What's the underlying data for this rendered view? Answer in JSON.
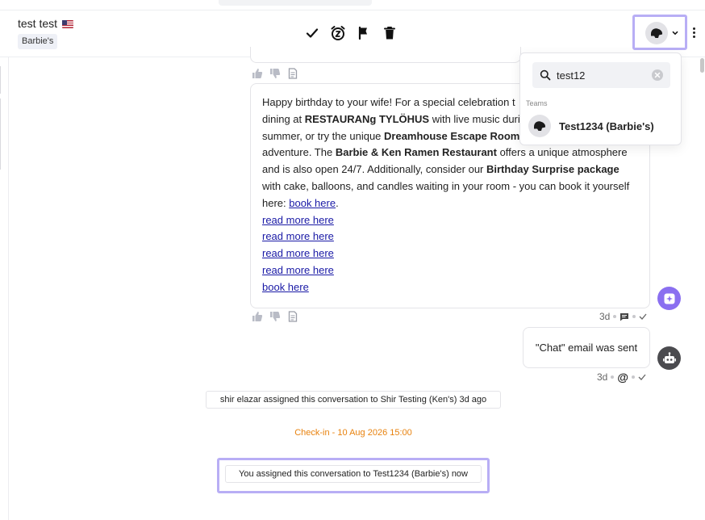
{
  "header": {
    "contact_name": "test test",
    "tag": "Barbie's"
  },
  "actions": [
    {
      "icon": "check-icon"
    },
    {
      "icon": "snooze-alarm-icon"
    },
    {
      "icon": "flag-icon"
    },
    {
      "icon": "trash-icon"
    }
  ],
  "assignee_dropdown": {
    "search_value": "test12",
    "section_label": "Teams",
    "team_option": "Test1234 (Barbie's)"
  },
  "ai_message": {
    "lines": [
      [
        "Happy birthday to your wife! For a special celebration t"
      ],
      [
        "dining at ",
        "RESTAURANg TYLÖHUS",
        " with live music durin"
      ],
      [
        "summer, or try the unique ",
        "Dreamhouse Escape Room"
      ],
      [
        "adventure. The ",
        "Barbie & Ken Ramen Restaurant",
        " offers a unique atmosphere"
      ],
      [
        "and is also open 24/7. Additionally, consider our ",
        "Birthday Surprise package"
      ],
      [
        "with cake, balloons, and candles waiting in your room - you can book it yourself"
      ],
      [
        "here: ",
        "book here",
        "."
      ]
    ],
    "links": [
      "read more here",
      "read more here",
      "read more here",
      "read more here",
      "book here"
    ],
    "time": "3d"
  },
  "system_message": {
    "text": "\"Chat\" email was sent",
    "time": "3d",
    "channel_symbol": "@"
  },
  "events": {
    "assignment_1": "shir elazar assigned this conversation to Shir Testing (Ken's) 3d ago",
    "checkin": "Check-in - 10 Aug 2026 15:00",
    "assignment_2": "You assigned this conversation to Test1234 (Barbie's) now"
  },
  "colors": {
    "highlight": "#b8aef5",
    "ai_accent": "#8a6ff0",
    "checkin": "#e8820e",
    "link": "#1a1aa6"
  }
}
